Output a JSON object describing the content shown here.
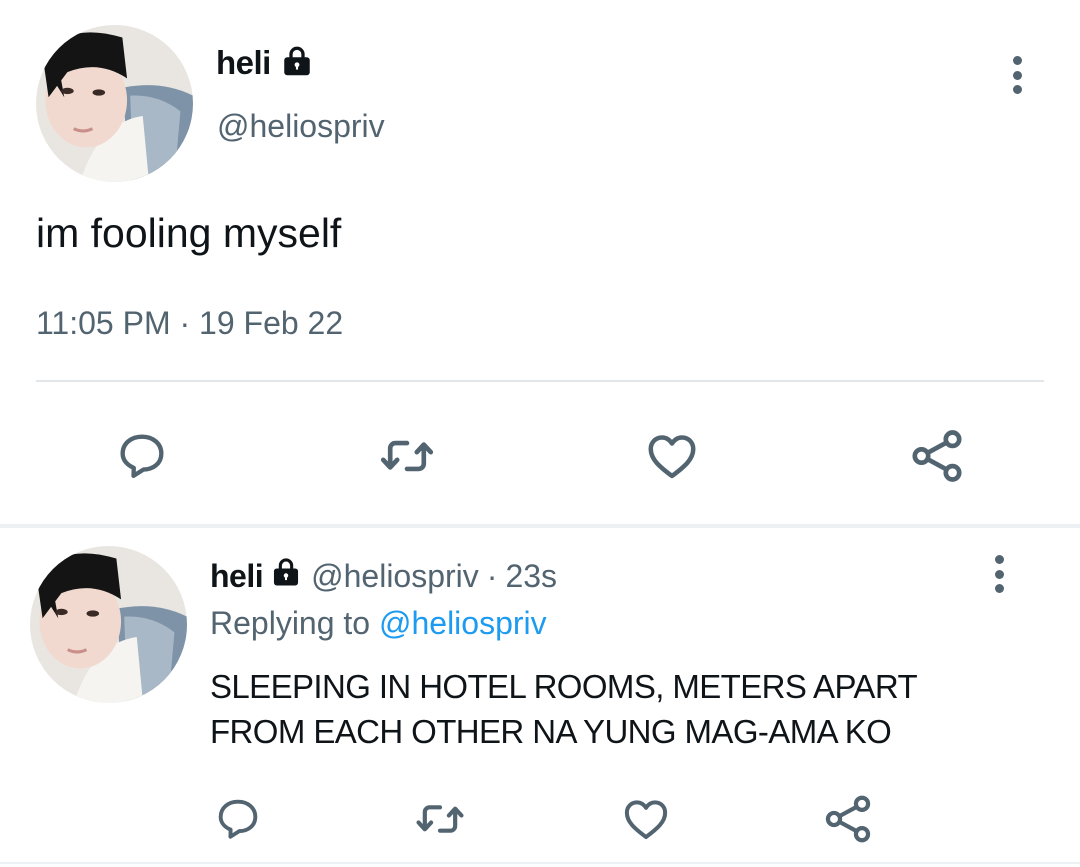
{
  "main_tweet": {
    "display_name": "heli",
    "handle": "@heliospriv",
    "text": "im fooling myself",
    "time": "11:05 PM",
    "separator": "·",
    "date": "19 Feb 22"
  },
  "reply_tweet": {
    "display_name": "heli",
    "handle": "@heliospriv",
    "separator": "·",
    "age": "23s",
    "replying_prefix": "Replying to",
    "replying_to": "@heliospriv",
    "text_line1": "SLEEPING IN HOTEL ROOMS, METERS APART",
    "text_line2": "FROM EACH OTHER NA YUNG MAG-AMA KO"
  },
  "icons": {
    "reply": "reply-icon",
    "retweet": "retweet-icon",
    "like": "heart-icon",
    "share": "share-icon",
    "more": "more-vertical-icon",
    "lock": "lock-icon"
  },
  "colors": {
    "text": "#0f1419",
    "secondary": "#536471",
    "link": "#1d9bf0",
    "divider": "#e3e7ea"
  }
}
